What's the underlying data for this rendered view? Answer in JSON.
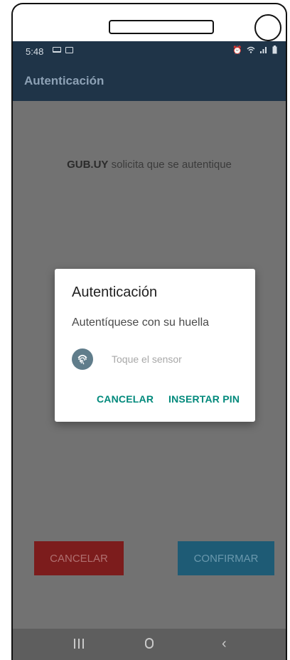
{
  "status_bar": {
    "time": "5:48",
    "left_icons": [
      "laptop-icon",
      "image-icon"
    ],
    "right_icons": [
      "alarm-icon",
      "wifi-icon",
      "signal-icon",
      "battery-icon"
    ]
  },
  "app_bar": {
    "title": "Autenticación"
  },
  "content": {
    "prompt_bold": "GUB.UY",
    "prompt_rest": " solicita que se autentique",
    "cancel_label": "CANCELAR",
    "confirm_label": "CONFIRMAR"
  },
  "dialog": {
    "title": "Autenticación",
    "subtitle": "Autentíquese con su huella",
    "fingerprint_hint": "Toque el sensor",
    "cancel_label": "CANCELAR",
    "pin_label": "INSERTAR PIN"
  },
  "nav_bar": {
    "icons": [
      "recents-icon",
      "home-icon",
      "back-icon"
    ]
  },
  "colors": {
    "app_bar": "#1f3448",
    "dialog_action": "#00897b",
    "cancel_button": "#7c1c1c",
    "confirm_button": "#1e5b75",
    "fingerprint_circle": "#607d8b"
  }
}
